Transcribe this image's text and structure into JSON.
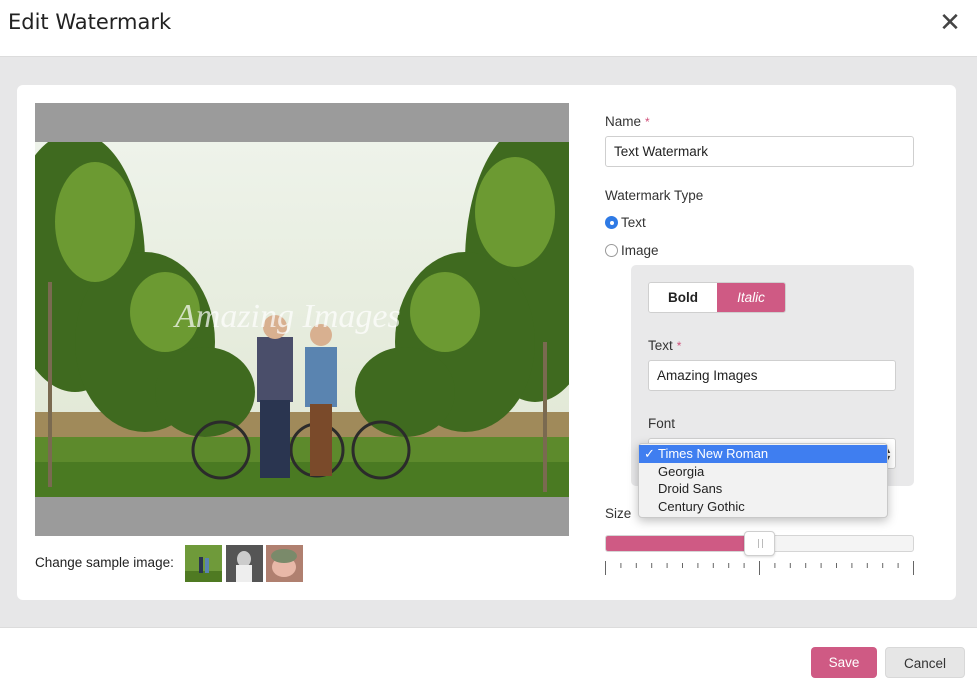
{
  "dialog": {
    "title": "Edit Watermark",
    "close_glyph": "✕"
  },
  "preview": {
    "watermark_text": "Amazing Images",
    "change_sample_label": "Change sample image:",
    "thumbnails": [
      "sample-couple-vineyard",
      "sample-bride",
      "sample-baby"
    ]
  },
  "form": {
    "name_label": "Name",
    "required_mark": "*",
    "name_value": "Text Watermark",
    "type_label": "Watermark Type",
    "type_options": [
      {
        "label": "Text",
        "selected": true
      },
      {
        "label": "Image",
        "selected": false
      }
    ],
    "bold_label": "Bold",
    "italic_label": "Italic",
    "italic_active": true,
    "text_label": "Text",
    "text_value": "Amazing Images",
    "font_label": "Font",
    "font_options": [
      "Times New Roman",
      "Georgia",
      "Droid Sans",
      "Century Gothic"
    ],
    "font_selected": "Times New Roman",
    "check_glyph": "✓",
    "size_label": "Size",
    "size_value": 0.5
  },
  "footer": {
    "save_label": "Save",
    "cancel_label": "Cancel"
  },
  "colors": {
    "accent": "#cf5a84",
    "select_highlight": "#3f7ef0",
    "radio_on": "#2f7ae5",
    "backdrop": "#e7e7e8"
  }
}
